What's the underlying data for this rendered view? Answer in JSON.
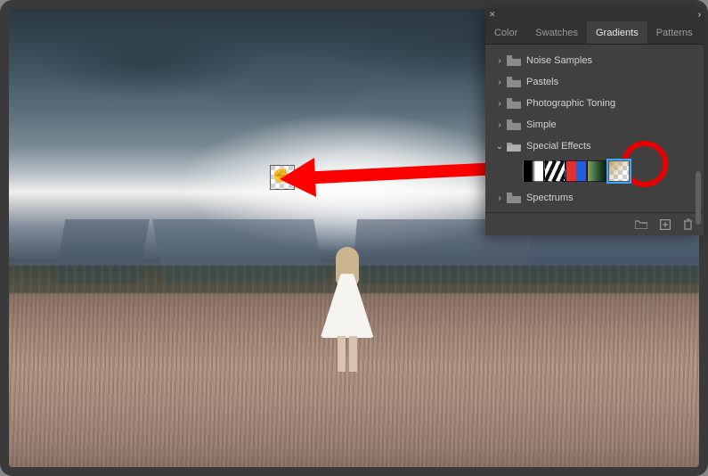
{
  "panel": {
    "tabs": {
      "color": "Color",
      "swatches": "Swatches",
      "gradients": "Gradients",
      "patterns": "Patterns"
    },
    "active_tab": "Gradients",
    "folders": {
      "noise_samples": "Noise Samples",
      "pastels": "Pastels",
      "photographic_toning": "Photographic Toning",
      "simple": "Simple",
      "special_effects": "Special Effects",
      "spectrums": "Spectrums"
    },
    "special_effects_presets": [
      {
        "name": "black-white-gradient"
      },
      {
        "name": "striped-gradient"
      },
      {
        "name": "red-blue-gradient"
      },
      {
        "name": "green-dark-gradient"
      },
      {
        "name": "foreground-to-transparent-gradient",
        "selected": true
      }
    ],
    "footer_icons": {
      "folder": "new-group",
      "new": "new-gradient",
      "trash": "delete"
    }
  },
  "annotation": {
    "action": "Drag gradient preset from Special Effects onto image canvas",
    "highlighted_preset": "foreground-to-transparent-gradient"
  }
}
